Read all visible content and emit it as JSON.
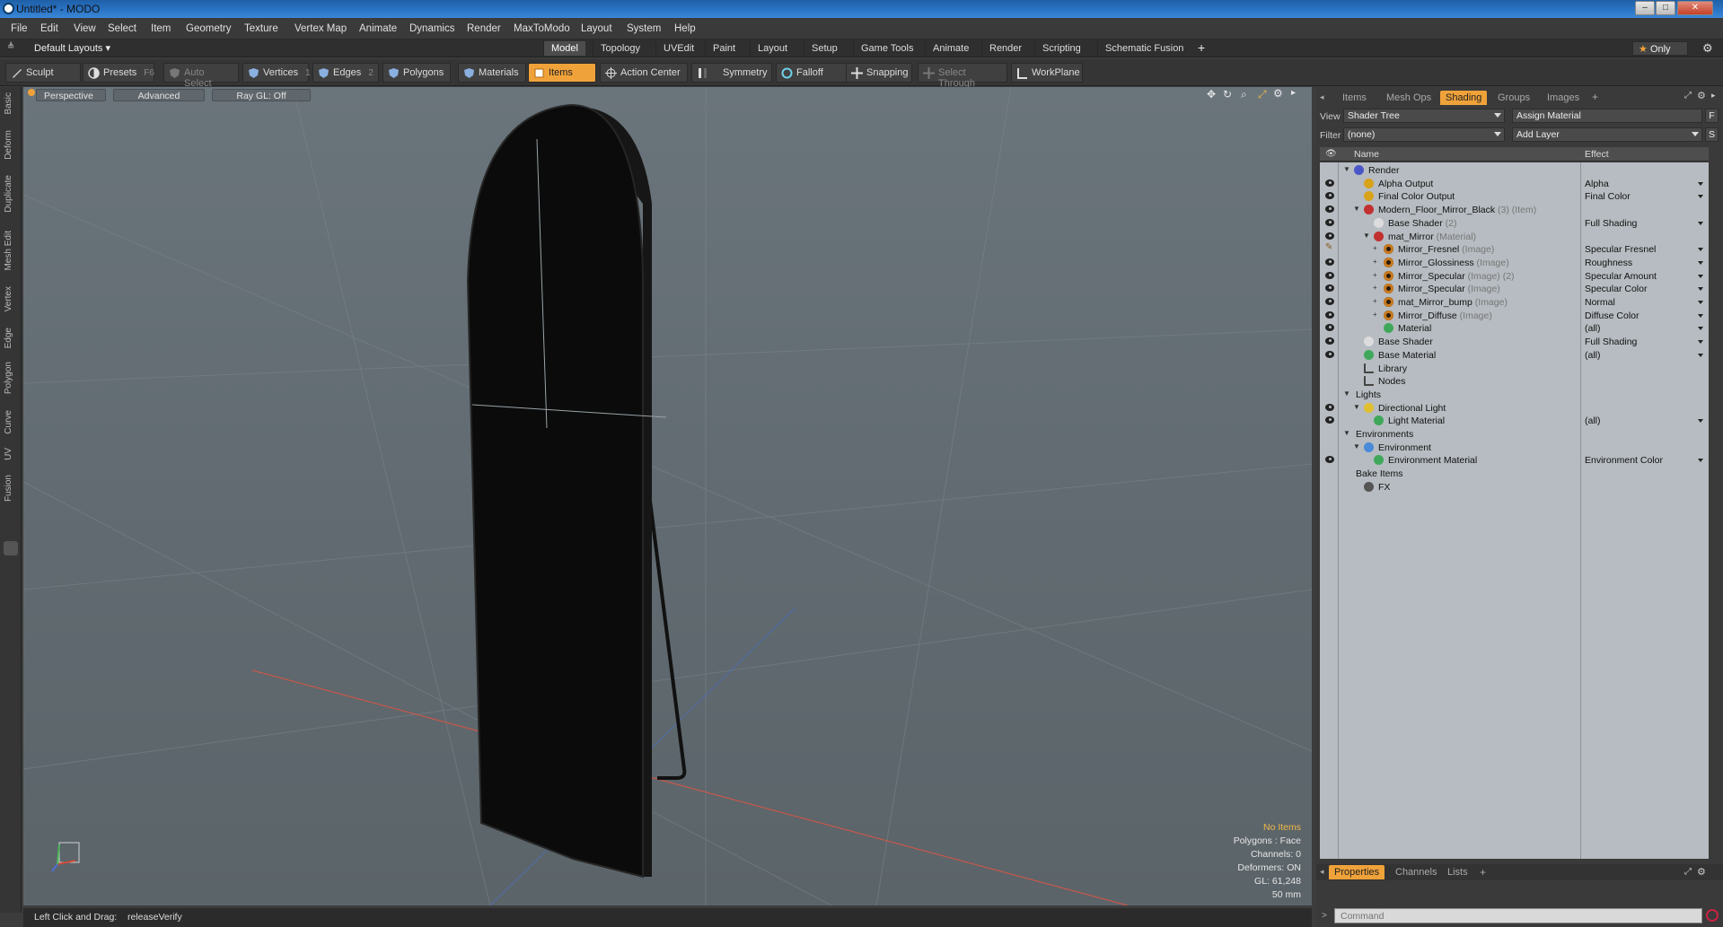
{
  "window": {
    "title": "Untitled* - MODO"
  },
  "menu": [
    "File",
    "Edit",
    "View",
    "Select",
    "Item",
    "Geometry",
    "Texture",
    "Vertex Map",
    "Animate",
    "Dynamics",
    "Render",
    "MaxToModo",
    "Layout",
    "System",
    "Help"
  ],
  "layout_bar": {
    "layout_selector": "Default Layouts",
    "tabs": [
      "Model",
      "Topology",
      "UVEdit",
      "Paint",
      "Layout",
      "Setup",
      "Game Tools",
      "Animate",
      "Render",
      "Scripting",
      "Schematic Fusion"
    ],
    "active_tab": "Model",
    "add_label": "+",
    "only_label": "Only"
  },
  "toolbar": {
    "sculpt": "Sculpt",
    "presets": "Presets",
    "presets_key": "F6",
    "auto_select": "Auto Select",
    "vertices": "Vertices",
    "vertices_key": "1",
    "edges": "Edges",
    "edges_key": "2",
    "polygons": "Polygons",
    "materials": "Materials",
    "items": "Items",
    "action_center": "Action Center",
    "symmetry": "Symmetry",
    "falloff": "Falloff",
    "snapping": "Snapping",
    "select_through": "Select Through",
    "workplane": "WorkPlane"
  },
  "left_tabs": [
    "Basic",
    "Deform",
    "Duplicate",
    "Mesh Edit",
    "Vertex",
    "Edge",
    "Polygon",
    "Curve",
    "UV",
    "Fusion"
  ],
  "viewport": {
    "perspective": "Perspective",
    "advanced": "Advanced",
    "raygl": "Ray GL: Off",
    "info": {
      "selection": "No Items",
      "polygons": "Polygons : Face",
      "channels": "Channels: 0",
      "deformers": "Deformers: ON",
      "gl": "GL: 61,248",
      "scale": "50 mm"
    }
  },
  "status": {
    "hint": "Left Click and Drag:",
    "action": "releaseVerify"
  },
  "right_panel": {
    "tabs": [
      "Items",
      "Mesh Ops",
      "Shading",
      "Groups",
      "Images"
    ],
    "active_tab": "Shading",
    "view_label": "View",
    "view_value": "Shader Tree",
    "assign_material": "Assign Material",
    "filter_label": "Filter",
    "filter_value": "(none)",
    "add_layer": "Add Layer",
    "f_btn": "F",
    "s_btn": "S",
    "col_name": "Name",
    "col_effect": "Effect",
    "tree": [
      {
        "indent": 0,
        "exp": "▼",
        "icon": "render",
        "name": "Render",
        "sub": "",
        "effect": "",
        "eye": false
      },
      {
        "indent": 1,
        "exp": "",
        "icon": "output",
        "name": "Alpha Output",
        "sub": "",
        "effect": "Alpha",
        "eye": true
      },
      {
        "indent": 1,
        "exp": "",
        "icon": "output",
        "name": "Final Color Output",
        "sub": "",
        "effect": "Final Color",
        "eye": true
      },
      {
        "indent": 1,
        "exp": "▼",
        "icon": "mask",
        "name": "Modern_Floor_Mirror_Black",
        "sub": "(3) (Item)",
        "effect": "",
        "eye": true
      },
      {
        "indent": 2,
        "exp": "",
        "icon": "shader",
        "name": "Base Shader",
        "sub": "(2)",
        "effect": "Full Shading",
        "eye": true
      },
      {
        "indent": 2,
        "exp": "▼",
        "icon": "mask",
        "name": "mat_Mirror",
        "sub": "(Material)",
        "effect": "",
        "eye": true
      },
      {
        "indent": 3,
        "exp": "+",
        "icon": "image",
        "name": "Mirror_Fresnel",
        "sub": "(Image)",
        "effect": "Specular Fresnel",
        "eye": false,
        "brush": true
      },
      {
        "indent": 3,
        "exp": "+",
        "icon": "image",
        "name": "Mirror_Glossiness",
        "sub": "(Image)",
        "effect": "Roughness",
        "eye": true
      },
      {
        "indent": 3,
        "exp": "+",
        "icon": "image",
        "name": "Mirror_Specular",
        "sub": "(Image) (2)",
        "effect": "Specular Amount",
        "eye": true
      },
      {
        "indent": 3,
        "exp": "+",
        "icon": "image",
        "name": "Mirror_Specular",
        "sub": "(Image)",
        "effect": "Specular Color",
        "eye": true
      },
      {
        "indent": 3,
        "exp": "+",
        "icon": "image",
        "name": "mat_Mirror_bump",
        "sub": "(Image)",
        "effect": "Normal",
        "eye": true
      },
      {
        "indent": 3,
        "exp": "+",
        "icon": "image",
        "name": "Mirror_Diffuse",
        "sub": "(Image)",
        "effect": "Diffuse Color",
        "eye": true
      },
      {
        "indent": 3,
        "exp": "",
        "icon": "material",
        "name": "Material",
        "sub": "",
        "effect": "(all)",
        "eye": true
      },
      {
        "indent": 1,
        "exp": "",
        "icon": "shader",
        "name": "Base Shader",
        "sub": "",
        "effect": "Full Shading",
        "eye": true
      },
      {
        "indent": 1,
        "exp": "",
        "icon": "material",
        "name": "Base Material",
        "sub": "",
        "effect": "(all)",
        "eye": true
      },
      {
        "indent": 1,
        "exp": "",
        "icon": "folder",
        "name": "Library",
        "sub": "",
        "effect": "",
        "eye": false
      },
      {
        "indent": 1,
        "exp": "",
        "icon": "folder",
        "name": "Nodes",
        "sub": "",
        "effect": "",
        "eye": false
      },
      {
        "indent": 0,
        "exp": "▼",
        "icon": "",
        "name": "Lights",
        "sub": "",
        "effect": "",
        "eye": false
      },
      {
        "indent": 1,
        "exp": "▼",
        "icon": "light",
        "name": "Directional Light",
        "sub": "",
        "effect": "",
        "eye": true
      },
      {
        "indent": 2,
        "exp": "",
        "icon": "material",
        "name": "Light Material",
        "sub": "",
        "effect": "(all)",
        "eye": true
      },
      {
        "indent": 0,
        "exp": "▼",
        "icon": "",
        "name": "Environments",
        "sub": "",
        "effect": "",
        "eye": false
      },
      {
        "indent": 1,
        "exp": "▼",
        "icon": "env",
        "name": "Environment",
        "sub": "",
        "effect": "",
        "eye": false
      },
      {
        "indent": 2,
        "exp": "",
        "icon": "material",
        "name": "Environment Material",
        "sub": "",
        "effect": "Environment Color",
        "eye": true
      },
      {
        "indent": 0,
        "exp": "",
        "icon": "",
        "name": "Bake Items",
        "sub": "",
        "effect": "",
        "eye": false
      },
      {
        "indent": 1,
        "exp": "",
        "icon": "fx",
        "name": "FX",
        "sub": "",
        "effect": "",
        "eye": false
      }
    ],
    "bottom_tabs": [
      "Properties",
      "Channels",
      "Lists"
    ],
    "bottom_active": "Properties",
    "command_placeholder": "Command"
  },
  "colors": {
    "accent": "#f0a23a",
    "viewport_bg": "#636c72",
    "tree_bg": "#b6bcc1"
  }
}
